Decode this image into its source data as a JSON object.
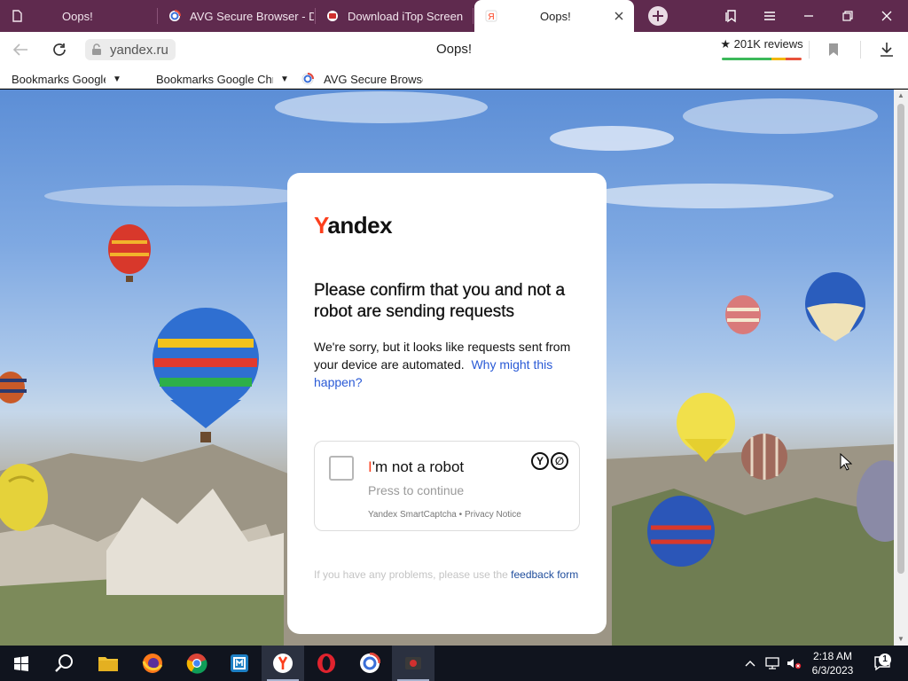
{
  "browser": {
    "tabs": [
      {
        "label": "Oops!",
        "icon": "document-icon",
        "active": false
      },
      {
        "label": "AVG Secure Browser - D",
        "icon": "avg-icon",
        "active": false
      },
      {
        "label": "Download iTop Screen",
        "icon": "itop-icon",
        "active": false
      },
      {
        "label": "Oops!",
        "icon": "yandex-icon",
        "active": true
      }
    ],
    "address": {
      "url": "yandex.ru",
      "page_title": "Oops!",
      "reviews": "★ 201K reviews"
    },
    "bookmarks": [
      {
        "label": "Bookmarks Google Chr",
        "has_menu": true
      },
      {
        "label": "Bookmarks Google Chr",
        "has_menu": true
      },
      {
        "label": "AVG Secure Browse",
        "has_menu": false
      }
    ]
  },
  "page": {
    "logo": {
      "first": "Y",
      "rest": "andex"
    },
    "heading": "Please confirm that you and not a robot are sending requests",
    "description": "We're sorry, but it looks like requests sent from your device are automated.",
    "why_link": "Why might this happen?",
    "captcha": {
      "title_first": "I",
      "title_rest": "'m not a robot",
      "subtitle": "Press to continue",
      "brand": "Yandex SmartCaptcha",
      "separator": " • ",
      "privacy_link": "Privacy Notice"
    },
    "help_text": "If you have any problems, please use the",
    "feedback_link": "feedback form"
  },
  "taskbar": {
    "apps": [
      "start-icon",
      "search-icon",
      "file-explorer-icon",
      "firefox-icon",
      "chrome-icon",
      "itop-app-icon",
      "yandex-browser-icon",
      "opera-icon",
      "avg-browser-icon",
      "itop-recorder-icon"
    ],
    "time": "2:18 AM",
    "date": "6/3/2023",
    "notification_count": "1"
  },
  "colors": {
    "tabstrip": "#5f2a4e",
    "yandex_red": "#fc3f1d",
    "link_blue": "#2a5ad6",
    "taskbar": "#10141e"
  }
}
